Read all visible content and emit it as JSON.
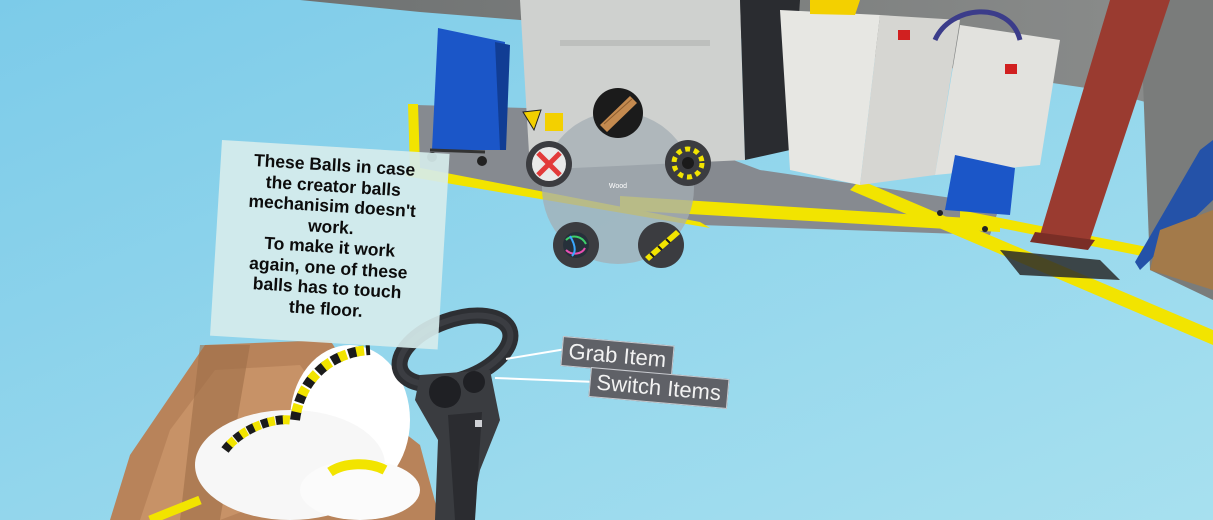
{
  "instruction_sign": {
    "text": "These Balls in case\nthe creator balls\nmechanisim doesn't\nwork.\nTo make it work\nagain, one of these\nballs has to touch\nthe floor."
  },
  "item_menu": {
    "selected_label": "Wood",
    "items": [
      {
        "name": "wood-item",
        "icon": "wood-plank-icon",
        "selected": true
      },
      {
        "name": "remove-item",
        "icon": "red-x-icon"
      },
      {
        "name": "striped-ball-item",
        "icon": "yellow-black-striped-icon"
      },
      {
        "name": "colorful-ball-item",
        "icon": "colorful-swirl-icon"
      },
      {
        "name": "caution-stick-item",
        "icon": "caution-stripe-stick-icon"
      }
    ]
  },
  "controller_tooltips": {
    "grab": "Grab Item",
    "switch": "Switch Items"
  },
  "colors": {
    "floor": "#8fd2ea",
    "floor_stripe": "#f2e400",
    "cabinet_blue": "#1b56c8",
    "crate": "#b8835a",
    "pillar_red": "#9a3b30",
    "tooltip_bg": "#5f6167"
  }
}
